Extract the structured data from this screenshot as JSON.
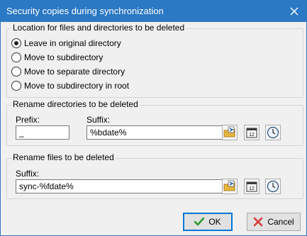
{
  "window": {
    "title": "Security copies during synchronization",
    "close_icon": "close-icon"
  },
  "location_group": {
    "title": "Location for files and directories to be deleted",
    "options": [
      {
        "label": "Leave in original directory",
        "checked": true
      },
      {
        "label": "Move to subdirectory",
        "checked": false
      },
      {
        "label": "Move to separate directory",
        "checked": false
      },
      {
        "label": "Move to subdirectory in root",
        "checked": false
      }
    ]
  },
  "rename_dirs_group": {
    "title": "Rename directories to be deleted",
    "prefix_label": "Prefix:",
    "prefix_value": "_",
    "suffix_label": "Suffix:",
    "suffix_value": "%bdate%",
    "icons": [
      "placeholder-insert-icon",
      "calendar-icon",
      "clock-icon"
    ]
  },
  "rename_files_group": {
    "title": "Rename files to be deleted",
    "suffix_label": "Suffix:",
    "suffix_value": "sync-%fdate%",
    "icons": [
      "placeholder-insert-icon",
      "calendar-icon",
      "clock-icon"
    ]
  },
  "buttons": {
    "ok_label": "OK",
    "cancel_label": "Cancel",
    "ok_icon": "checkmark-icon",
    "cancel_icon": "x-icon"
  },
  "colors": {
    "titlebar": "#2b78c4",
    "ok_border": "#0078d7",
    "check_green": "#2e9b2e",
    "cancel_red": "#d93a3a"
  }
}
